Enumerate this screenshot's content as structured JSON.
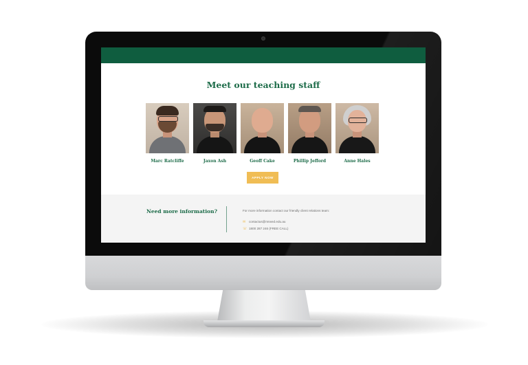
{
  "page": {
    "heading": "Meet our teaching staff",
    "apply_label": "APPLY NOW",
    "staff": [
      {
        "name": "Marc Ratcliffe"
      },
      {
        "name": "Jaxon Ash"
      },
      {
        "name": "Geoff Cake"
      },
      {
        "name": "Phillip Jefford"
      },
      {
        "name": "Anne Hales"
      }
    ],
    "info": {
      "title": "Need more information?",
      "text": "For more information contact our friendly client relations team:",
      "email": "contactus@mrwed.edu.au",
      "phone": "1800 287 246 (FREE CALL)"
    }
  },
  "icons": {
    "email": "envelope-icon",
    "phone": "phone-icon"
  },
  "colors": {
    "brand_green": "#0f5d3f",
    "heading_green": "#1c6b48",
    "accent_yellow": "#f0bd55",
    "info_bg": "#f4f4f4"
  }
}
